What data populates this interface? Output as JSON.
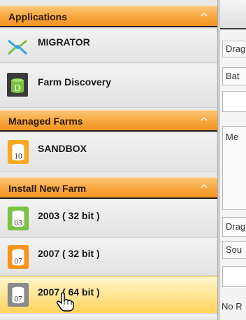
{
  "sections": [
    {
      "title": "Applications",
      "items": [
        {
          "label": "MIGRATOR",
          "icon": "migrator-icon"
        },
        {
          "label": "Farm Discovery",
          "icon": "farm-discovery-icon",
          "icon_letter": "D"
        }
      ]
    },
    {
      "title": "Managed Farms",
      "items": [
        {
          "label": "SANDBOX",
          "icon": "sandbox-database-icon",
          "icon_text": "10"
        }
      ]
    },
    {
      "title": "Install New Farm",
      "items": [
        {
          "label": "2003 ( 32 bit )",
          "icon": "database-03-icon",
          "icon_text": "03"
        },
        {
          "label": "2007 ( 32 bit )",
          "icon": "database-07-orange-icon",
          "icon_text": "07"
        },
        {
          "label": "2007 ( 64 bit )",
          "icon": "database-07-gray-icon",
          "icon_text": "07",
          "hovered": true
        }
      ]
    }
  ],
  "right_pane": {
    "drag_1": "Drag",
    "bat": "Bat",
    "me": "Me",
    "drag_2": "Drag",
    "sou": "Sou",
    "no_r": "No R"
  },
  "colors": {
    "header_orange": "#f8a63d",
    "green_db": "#7cc242",
    "orange_db": "#f7941d",
    "gray_db": "#8a8a8a",
    "hover_yellow": "#ffd35a"
  }
}
